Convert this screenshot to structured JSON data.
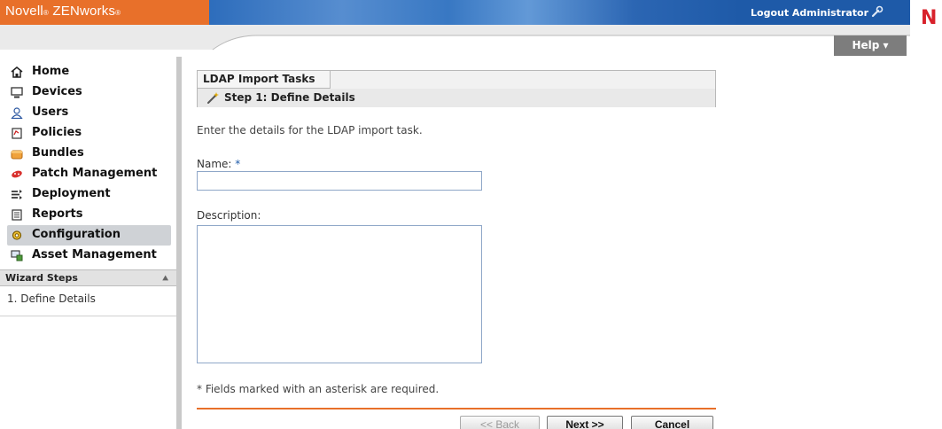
{
  "header": {
    "brand": "Novell",
    "product": "ZENworks",
    "logout_label": "Logout Administrator",
    "help_label": "Help ▾",
    "novell_letter": "N"
  },
  "sidebar": {
    "items": [
      {
        "label": "Home",
        "icon": "home-icon"
      },
      {
        "label": "Devices",
        "icon": "monitor-icon"
      },
      {
        "label": "Users",
        "icon": "user-icon"
      },
      {
        "label": "Policies",
        "icon": "policy-icon"
      },
      {
        "label": "Bundles",
        "icon": "bundle-icon"
      },
      {
        "label": "Patch Management",
        "icon": "patch-icon"
      },
      {
        "label": "Deployment",
        "icon": "deployment-icon"
      },
      {
        "label": "Reports",
        "icon": "report-icon"
      },
      {
        "label": "Configuration",
        "icon": "configuration-icon",
        "active": true
      },
      {
        "label": "Asset Management",
        "icon": "asset-icon"
      }
    ],
    "wizard_title": "Wizard Steps",
    "wizard_steps": [
      "1. Define Details"
    ]
  },
  "main": {
    "tab_title": "LDAP Import Tasks",
    "step_title": "Step 1: Define Details",
    "intro": "Enter the details for the LDAP import task.",
    "name_label": "Name:",
    "required_mark": "*",
    "name_value": "",
    "description_label": "Description:",
    "description_value": "",
    "footnote": "* Fields marked with an asterisk are required."
  },
  "buttons": {
    "back": "<< Back",
    "next": "Next >>",
    "cancel": "Cancel"
  },
  "colors": {
    "brand_orange": "#e8702a",
    "header_blue": "#1e5aa8",
    "novell_red": "#d8212b"
  }
}
